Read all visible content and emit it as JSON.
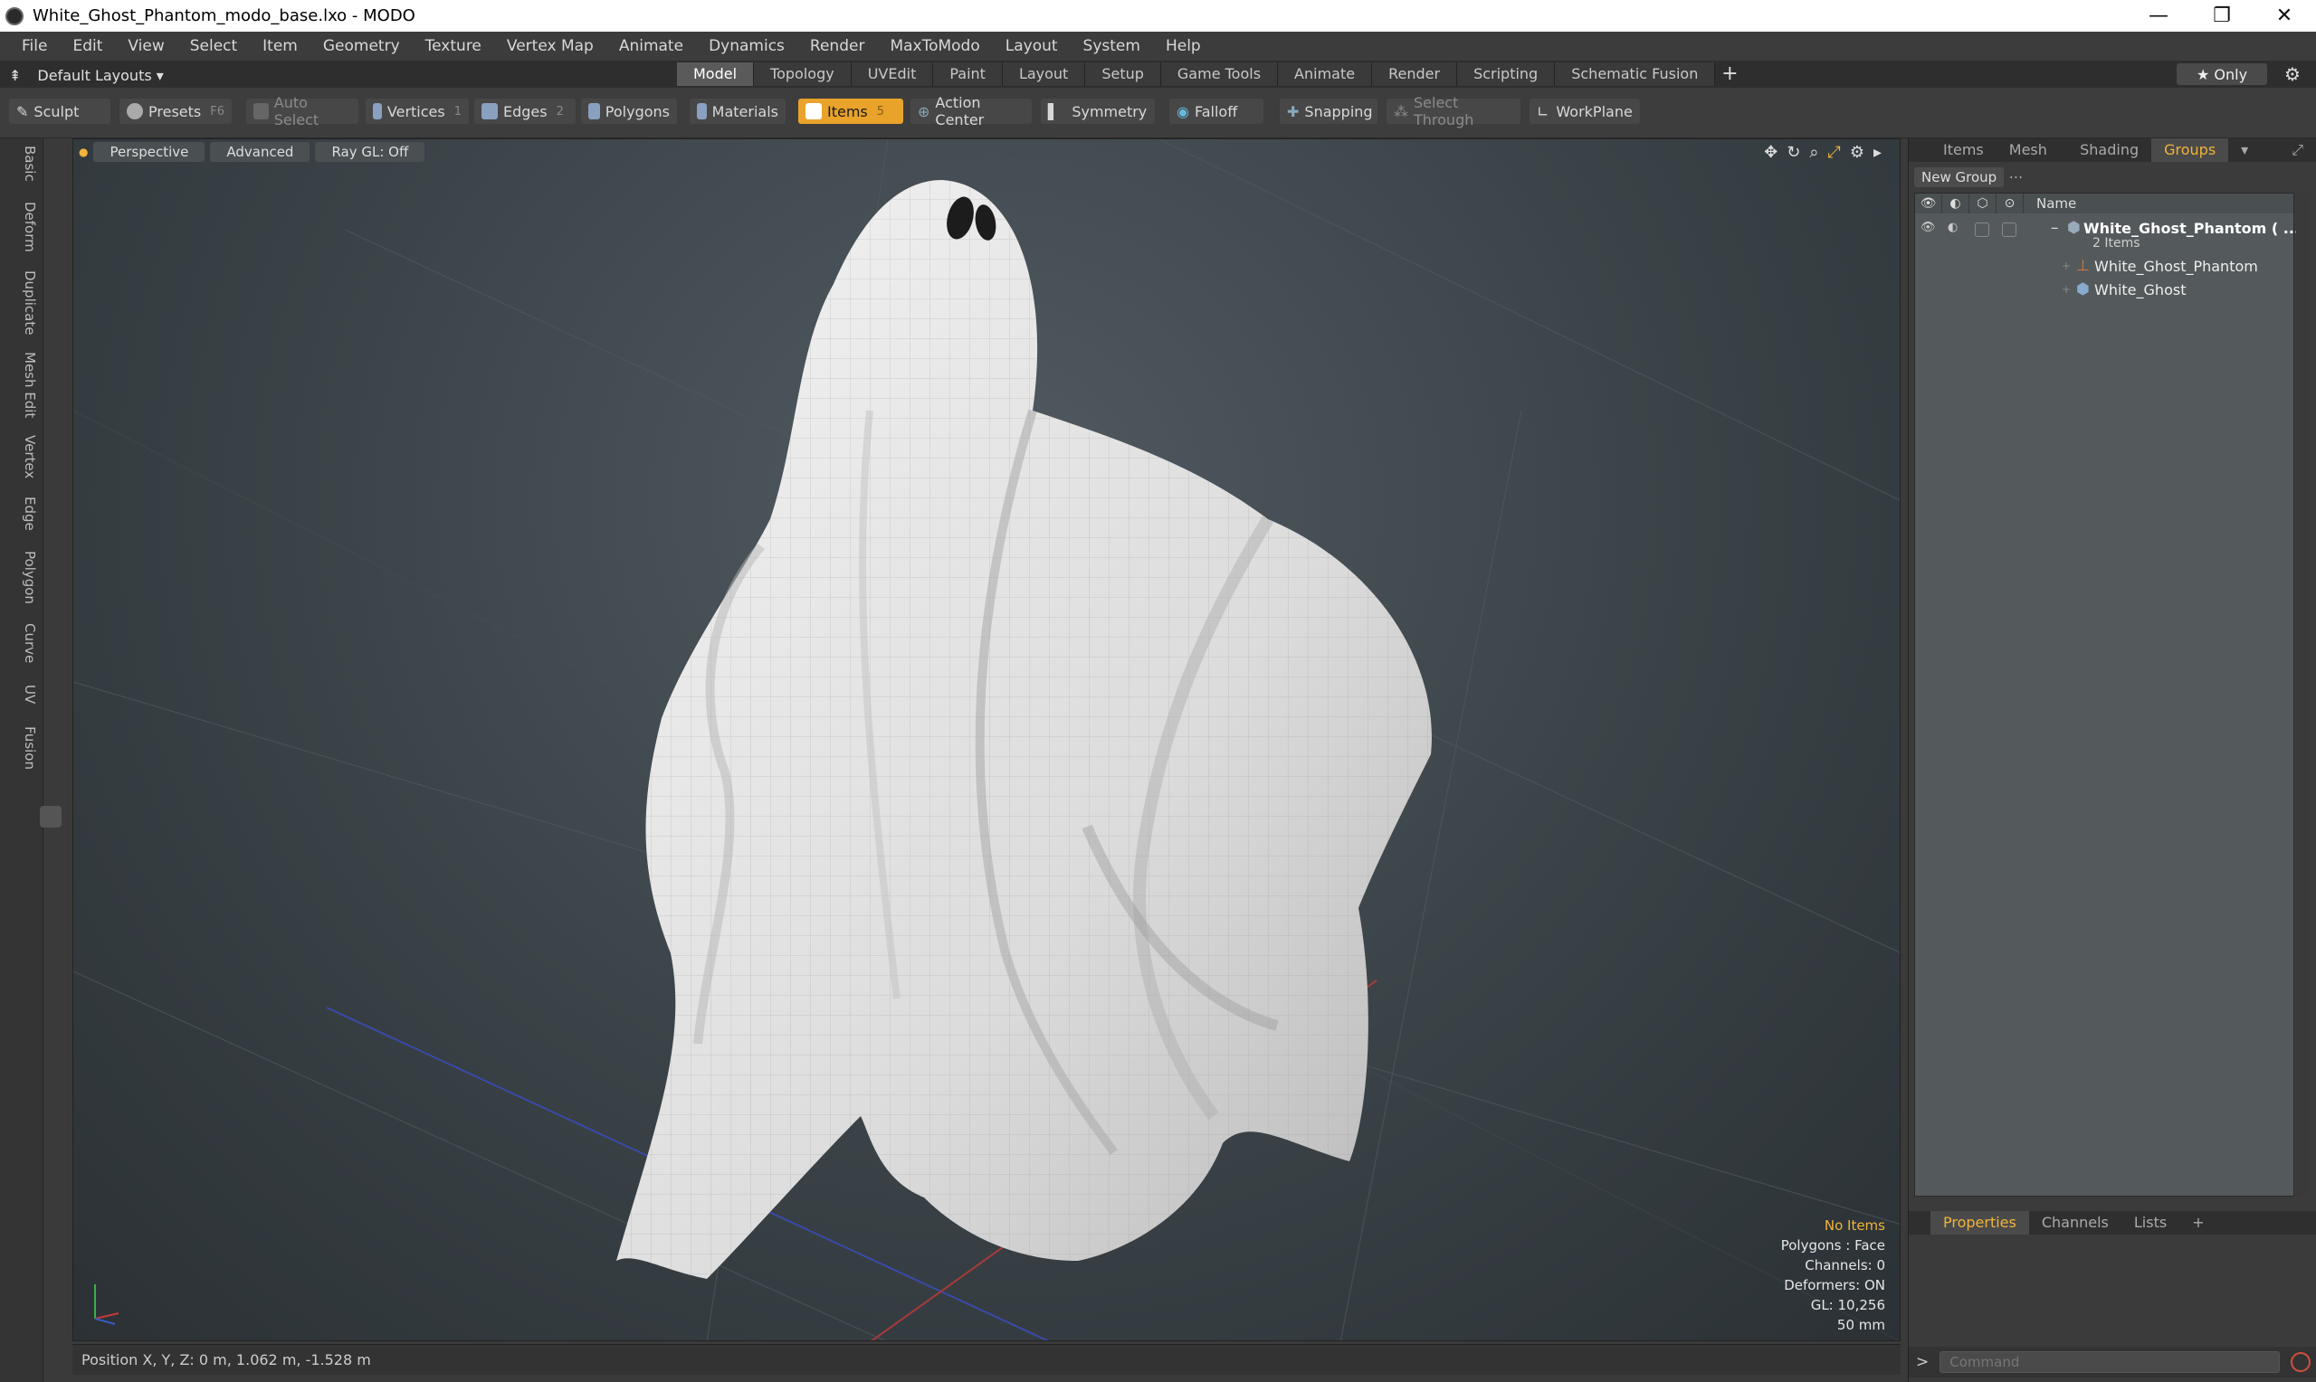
{
  "window": {
    "title": "White_Ghost_Phantom_modo_base.lxo - MODO",
    "controls": [
      "—",
      "❐",
      "✕"
    ]
  },
  "menu": [
    "File",
    "Edit",
    "View",
    "Select",
    "Item",
    "Geometry",
    "Texture",
    "Vertex Map",
    "Animate",
    "Dynamics",
    "Render",
    "MaxToModo",
    "Layout",
    "System",
    "Help"
  ],
  "layouts": {
    "label": "Default Layouts ▾"
  },
  "tabs": [
    "Model",
    "Topology",
    "UVEdit",
    "Paint",
    "Layout",
    "Setup",
    "Game Tools",
    "Animate",
    "Render",
    "Scripting",
    "Schematic Fusion"
  ],
  "active_tab": "Model",
  "only_label": "★ Only",
  "toolbar": {
    "sculpt": "Sculpt",
    "presets": "Presets",
    "presets_key": "F6",
    "auto_select": "Auto Select",
    "vertices": "Vertices",
    "vertices_count": "1",
    "edges": "Edges",
    "edges_count": "2",
    "polygons": "Polygons",
    "materials": "Materials",
    "items": "Items",
    "items_count": "5",
    "action_center": "Action Center",
    "symmetry": "Symmetry",
    "falloff": "Falloff",
    "snapping": "Snapping",
    "select_through": "Select Through",
    "workplane": "WorkPlane"
  },
  "left_tabs": [
    "Basic",
    "Deform",
    "Duplicate",
    "Mesh Edit",
    "Vertex",
    "Edge",
    "Polygon",
    "Curve",
    "UV",
    "Fusion"
  ],
  "viewport": {
    "perspective": "Perspective",
    "advanced": "Advanced",
    "raygl": "Ray GL: Off",
    "info": {
      "no_items": "No Items",
      "polygons": "Polygons : Face",
      "channels": "Channels: 0",
      "deformers": "Deformers: ON",
      "gl": "GL: 10,256",
      "scale": "50 mm"
    }
  },
  "status": {
    "position": "Position X, Y, Z:  0 m, 1.062 m, -1.528 m"
  },
  "right_panel": {
    "tabs": [
      "Items",
      "Mesh ...",
      "Shading",
      "Groups"
    ],
    "active_tab": "Groups",
    "new_group": "New Group",
    "name_header": "Name",
    "tree": {
      "group_name": "White_Ghost_Phantom ( ...",
      "group_sub": "2 Items",
      "children": [
        "White_Ghost_Phantom",
        "White_Ghost"
      ]
    },
    "bottom_tabs": [
      "Properties",
      "Channels",
      "Lists",
      "+"
    ],
    "bottom_active": "Properties",
    "command_placeholder": "Command"
  },
  "colors": {
    "accent": "#f2b43a",
    "active_tool": "#e9a32a"
  }
}
